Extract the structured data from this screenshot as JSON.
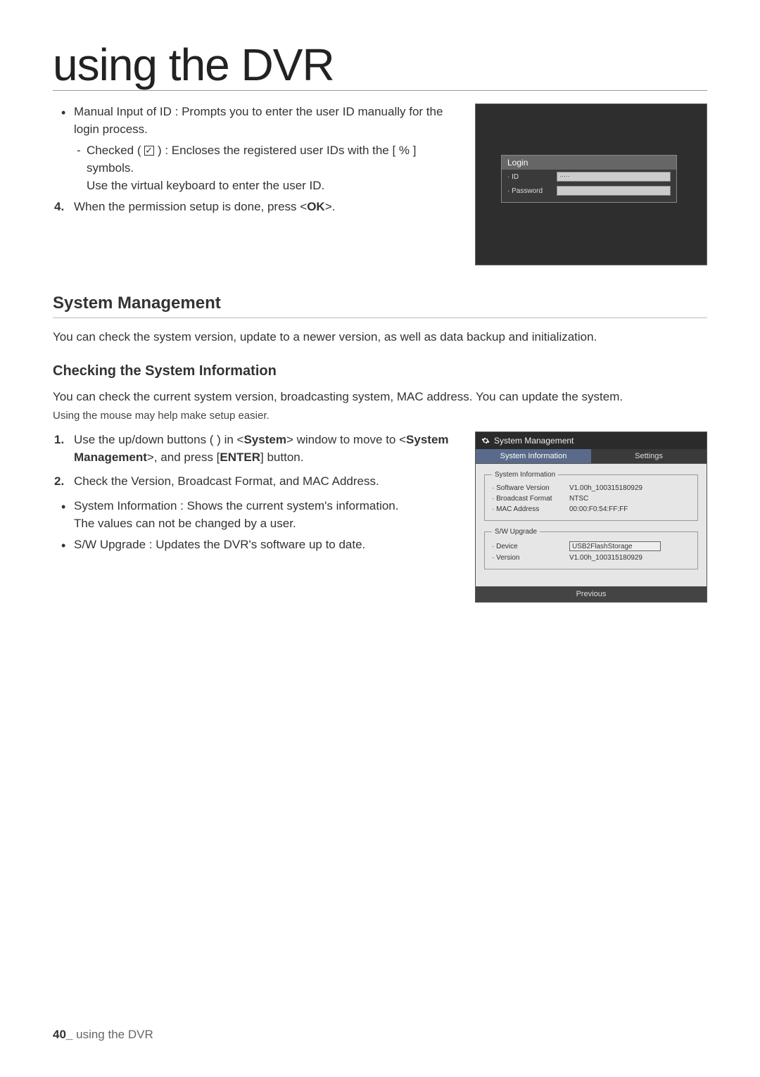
{
  "page": {
    "main_title": "using the DVR",
    "footer_page": "40_",
    "footer_text": "using the DVR"
  },
  "top_block": {
    "bullet1_a": "Manual Input of ID : Prompts you to enter the user ID manually for the login process.",
    "dash1_pre": "Checked (",
    "dash1_post": ") : Encloses the registered user IDs with the [ % ] symbols.",
    "dash1_line2": "Use the virtual keyboard to enter the user ID.",
    "step4_num": "4.",
    "step4_a": "When the permission setup is done, press <",
    "step4_b": "OK",
    "step4_c": ">."
  },
  "login_panel": {
    "title": "Login",
    "id_label": "· ID",
    "id_value": "·····",
    "pwd_label": "· Password",
    "pwd_value": ""
  },
  "section": {
    "title": "System Management",
    "intro": "You can check the system version, update to a newer version, as well as data backup and initialization."
  },
  "subsection": {
    "title": "Checking the System Information",
    "intro": "You can check the current system version, broadcasting system, MAC address. You can update the system.",
    "note": "Using the mouse may help make setup easier.",
    "step1_num": "1.",
    "step1_a": "Use the up/down buttons (      ) in <",
    "step1_b": "System",
    "step1_c": "> window to move to <",
    "step1_d": "System Management",
    "step1_e": ">, and press [",
    "step1_f": "ENTER",
    "step1_g": "] button.",
    "step2_num": "2.",
    "step2_text": "Check the Version, Broadcast Format, and MAC Address.",
    "bullet_sysinfo_a": "System Information : Shows the current system's information.",
    "bullet_sysinfo_b": "The values can not be changed by a user.",
    "bullet_sw": "S/W Upgrade : Updates the DVR's software up to date."
  },
  "sys_panel": {
    "titlebar": "System Management",
    "tab_active": "System Information",
    "tab_other": "Settings",
    "group1_legend": "System Information",
    "row_sw_label": "· Software Version",
    "row_sw_value": "V1.00h_100315180929",
    "row_bf_label": "· Broadcast Format",
    "row_bf_value": "NTSC",
    "row_mac_label": "· MAC Address",
    "row_mac_value": "00:00:F0:54:FF:FF",
    "group2_legend": "S/W Upgrade",
    "row_dev_label": "· Device",
    "row_dev_value": "USB2FlashStorage",
    "row_ver_label": "· Version",
    "row_ver_value": "V1.00h_100315180929",
    "prev_button": "Previous"
  },
  "chart_data": {
    "type": "table",
    "title": "System Information",
    "rows": [
      {
        "label": "Software Version",
        "value": "V1.00h_100315180929"
      },
      {
        "label": "Broadcast Format",
        "value": "NTSC"
      },
      {
        "label": "MAC Address",
        "value": "00:00:F0:54:FF:FF"
      },
      {
        "label": "Device",
        "value": "USB2FlashStorage"
      },
      {
        "label": "Version",
        "value": "V1.00h_100315180929"
      }
    ]
  }
}
